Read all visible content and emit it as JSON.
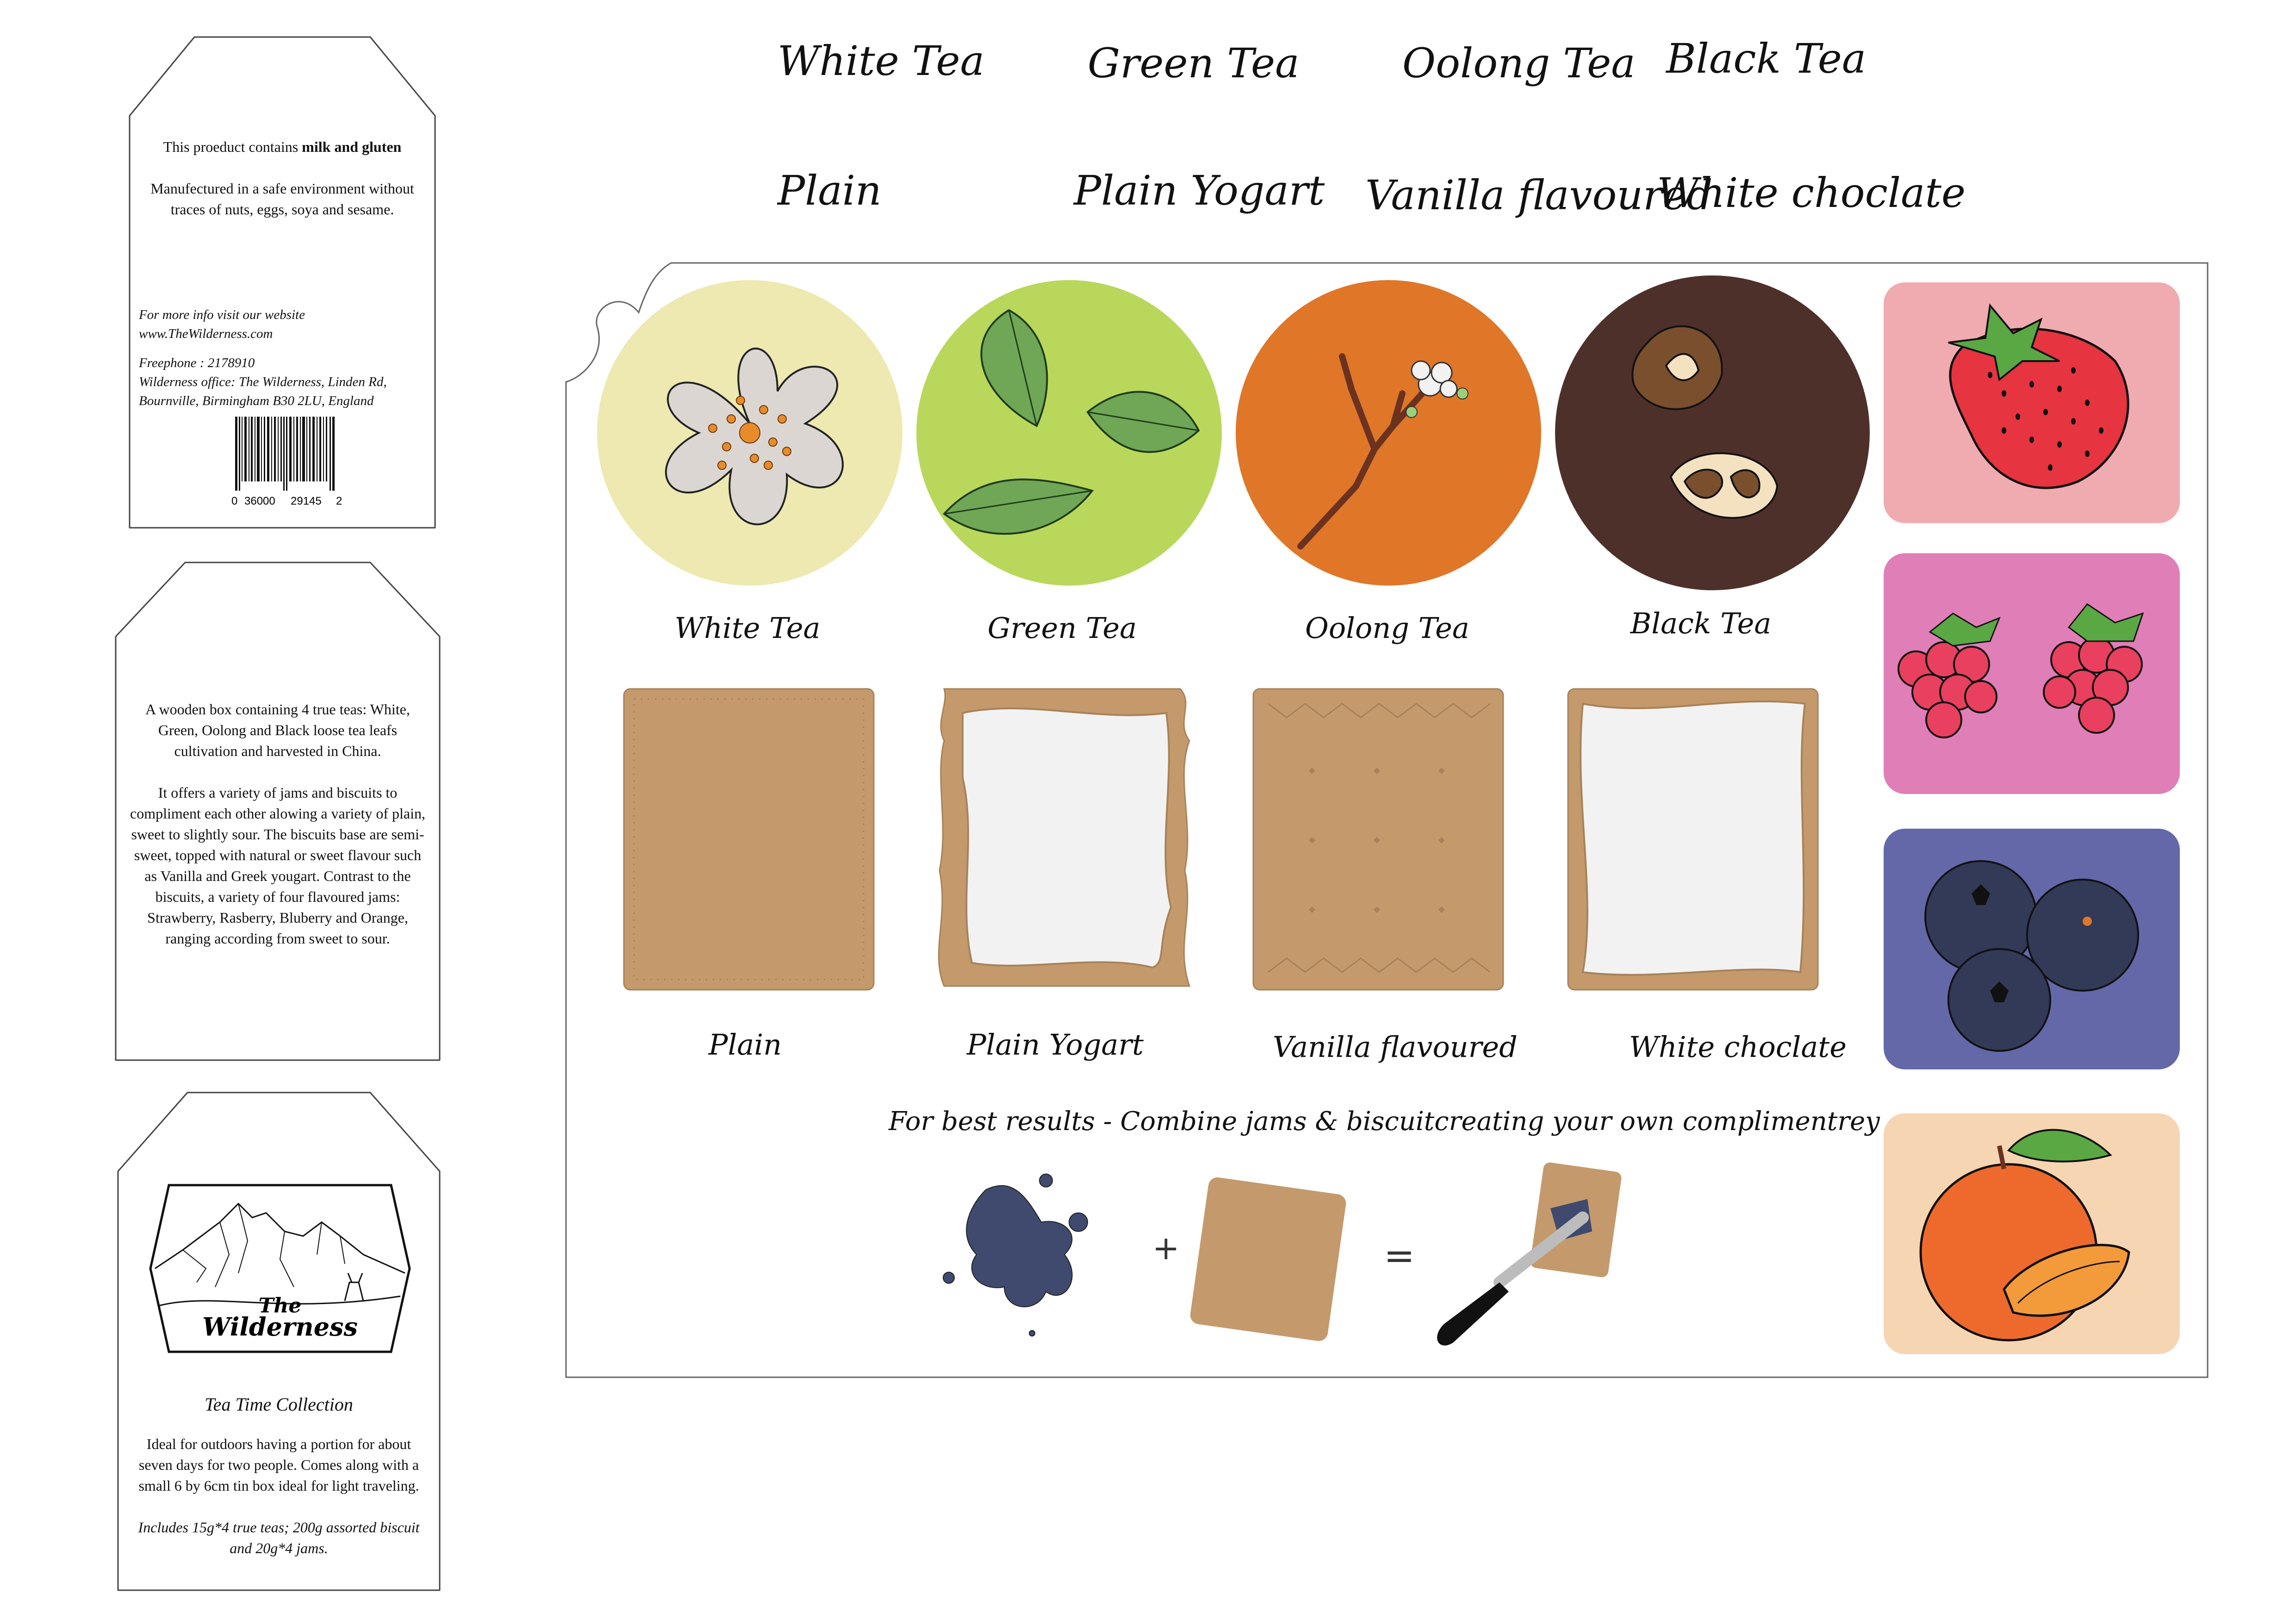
{
  "header": {
    "teas": [
      "White Tea",
      "Green Tea",
      "Oolong Tea",
      "Black Tea"
    ],
    "biscuits": [
      "Plain",
      "Plain Yogart",
      "Vanilla flavoured",
      "White choclate"
    ]
  },
  "tag1": {
    "allergen_prefix": "This proeduct contains ",
    "allergen_bold": "milk and gluten",
    "manufacture": "Manufectured in a safe environment without traces of nuts, eggs, soya and sesame.",
    "info_line1": "For more info visit our website",
    "info_line2": "www.TheWilderness.com",
    "freephone": "Freephone : 2178910",
    "office": "Wilderness office: The Wilderness, Linden Rd, Bournville, Birmingham B30 2LU, England",
    "barcode_digits": [
      "0",
      "36000",
      "29145",
      "2"
    ]
  },
  "tag2": {
    "para1": "A wooden box containing 4 true teas: White, Green, Oolong and Black loose tea leafs cultivation and harvested in China.",
    "para2": "It offers a variety of jams and biscuits to compliment each other alowing  a variety of plain, sweet to slightly sour. The biscuits base are semi-sweet,  topped with natural or sweet flavour such as Vanilla and Greek yougart. Contrast to the biscuits, a variety of four flavoured jams: Strawberry, Rasberry, Bluberry and Orange, ranging according from sweet to sour."
  },
  "tag3": {
    "logo_text_1": "The",
    "logo_text_2": "Wilderness",
    "collection": "Tea Time Collection",
    "desc": "Ideal for outdoors having a portion for about seven days for two people. Comes along with a small 6 by 6cm tin box ideal for light traveling.",
    "includes": "Includes  15g*4 true teas; 200g  assorted biscuit and 20g*4 jams."
  },
  "panel": {
    "tea_labels": [
      "White Tea",
      "Green Tea",
      "Oolong Tea",
      "Black Tea"
    ],
    "biscuit_labels": [
      "Plain",
      "Plain Yogart",
      "Vanilla flavoured",
      "White choclate"
    ],
    "tip": "For best results - Combine  jams & biscuitcreating your own complimentrey",
    "plus": "+",
    "equals": "="
  },
  "colors": {
    "white_tea": "#ede9b0",
    "green_tea": "#b9d75a",
    "oolong_tea": "#e07628",
    "black_tea": "#4e302a",
    "biscuit": "#c49a6c",
    "strawberry_bg": "#f0abb0",
    "raspberry_bg": "#e07eb8",
    "blueberry_bg": "#6468a8",
    "orange_bg": "#f6d5b2"
  }
}
